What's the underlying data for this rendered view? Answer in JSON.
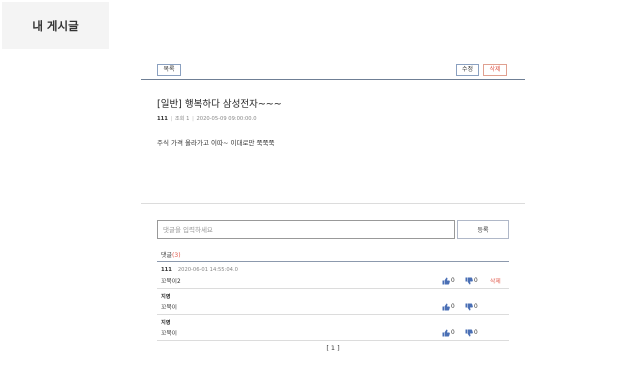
{
  "sidebar": {
    "tab_label": "내 게시글"
  },
  "toolbar": {
    "list_label": "목록",
    "edit_label": "수정",
    "delete_label": "삭제"
  },
  "post": {
    "title": "[일반] 행복하다 삼성전자~~~",
    "author": "111",
    "views_label": "조회 1",
    "date": "2020-05-09 09:00:00.0",
    "body": "주식 가격 올라가고 이따~ 이대로만 쭉쭉쭉"
  },
  "comment_form": {
    "placeholder": "댓글을 입력하세요",
    "submit_label": "등록"
  },
  "comments_header": {
    "label": "댓글",
    "count": "(3)"
  },
  "comments": [
    {
      "author": "111",
      "date": "2020-06-01 14:55:04.0",
      "text": "꼬북이2",
      "likes": "0",
      "dislikes": "0",
      "delete_label": "삭제"
    },
    {
      "author": "지영",
      "date": "",
      "text": "꼬북이",
      "likes": "0",
      "dislikes": "0",
      "delete_label": ""
    },
    {
      "author": "지영",
      "date": "",
      "text": "꼬북이",
      "likes": "0",
      "dislikes": "0",
      "delete_label": ""
    }
  ],
  "pagination": {
    "label": "[ 1 ]"
  },
  "icons": {
    "like": "thumbs-up-icon",
    "dislike": "thumbs-down-icon"
  },
  "colors": {
    "accent_red": "#e0584a",
    "rule_blue": "#6f7f95",
    "icon_blue": "#4a6fb5"
  }
}
